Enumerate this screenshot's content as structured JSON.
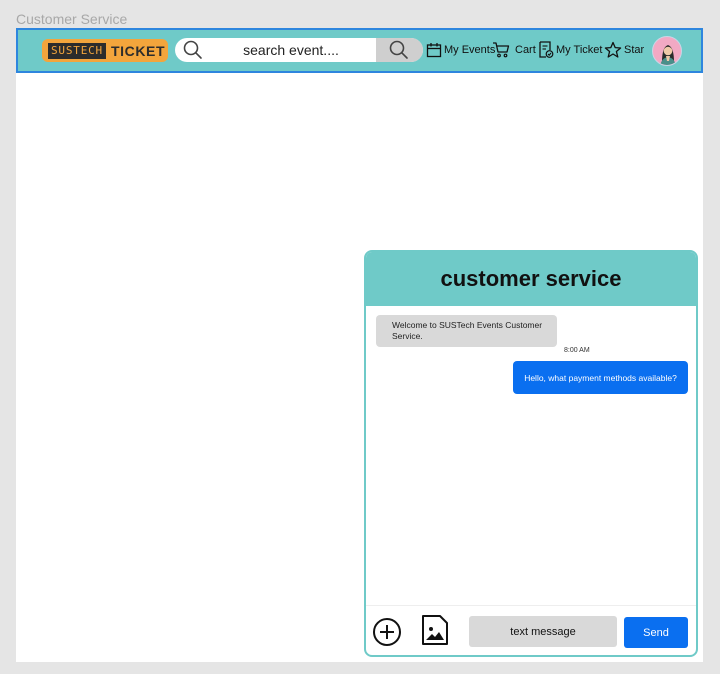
{
  "frame_label": "Customer Service",
  "header": {
    "logo_left": "SUSTECH",
    "logo_right": "TICKET",
    "search_placeholder": "search event....",
    "nav": {
      "my_events": "My Events",
      "cart": "Cart",
      "my_ticket": "My Ticket",
      "star": "Star"
    }
  },
  "chat": {
    "title": "customer service",
    "messages": [
      {
        "from": "agent",
        "text": "Welcome to SUSTech Events Customer Service.",
        "time": "8:00 AM"
      },
      {
        "from": "user",
        "text": "Hello, what payment methods  available?"
      }
    ],
    "input_placeholder": "text message",
    "send_label": "Send"
  },
  "colors": {
    "teal": "#6fcac8",
    "orange": "#f3a53c",
    "blue": "#0a6ff0",
    "gray": "#d9d9d9"
  }
}
